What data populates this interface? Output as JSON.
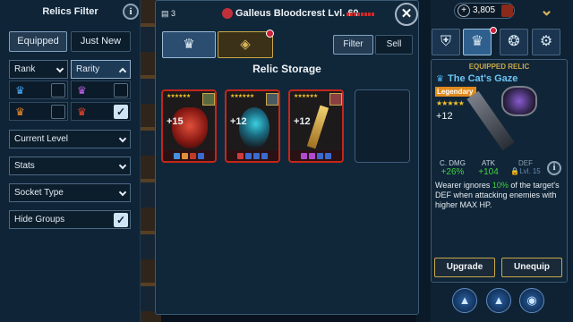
{
  "filter": {
    "title": "Relics Filter",
    "info_icon": "i",
    "tabs": [
      "Equipped",
      "Just New"
    ],
    "rank_label": "Rank",
    "rarity_label": "Rarity",
    "rank_options": [
      {
        "icon": "♛",
        "color": "#4aa6f0"
      },
      {
        "icon": "♛",
        "color": "#e98a2a"
      }
    ],
    "rarity_options": [
      {
        "icon": "♛",
        "color": "#c060e8"
      },
      {
        "icon": "♛",
        "color": "#e8452a"
      }
    ],
    "current_level": "Current Level",
    "stats": "Stats",
    "socket_type": "Socket Type",
    "hide_groups": "Hide Groups",
    "checkmark": "✓"
  },
  "header": {
    "card_count": "3",
    "hero_name": "Galleus Bloodcrest Lvl. 60",
    "close": "✕"
  },
  "storage": {
    "title": "Relic Storage",
    "filter_btn": "Filter",
    "sell_btn": "Sell",
    "relics": [
      {
        "plus": "+15",
        "stars": "★★★★★★",
        "gems": [
          "#4a8ee0",
          "#e0903a",
          "#c03a2a",
          "#3a6ad0"
        ]
      },
      {
        "plus": "+12",
        "stars": "★★★★★★",
        "gems": [
          "#d03a3a",
          "#3a6ad0",
          "#3a6ad0",
          "#3a6ad0"
        ]
      },
      {
        "plus": "+12",
        "stars": "★★★★★★",
        "gems": [
          "#b04ad0",
          "#b04ad0",
          "#3a6ad0",
          "#3a6ad0"
        ]
      }
    ]
  },
  "currency": {
    "amount": "3,805"
  },
  "equipped": {
    "heading": "EQUIPPED RELIC",
    "name": "The Cat's Gaze",
    "rarity": "Legendary",
    "stars": "★★★★★",
    "plus": "+12",
    "stats": [
      {
        "label": "C. DMG",
        "value": "+26%"
      },
      {
        "label": "ATK",
        "value": "+104"
      },
      {
        "label": "DEF",
        "value": "Lvl. 15"
      }
    ],
    "desc_pre": "Wearer ignores ",
    "desc_hl": "10%",
    "desc_post": " of the target's DEF when attacking enemies with higher MAX HP.",
    "upgrade": "Upgrade",
    "unequip": "Unequip"
  },
  "colors": {
    "accent": "#c9a84a",
    "legendary": "#e08a1c",
    "green": "#3fd13f"
  }
}
